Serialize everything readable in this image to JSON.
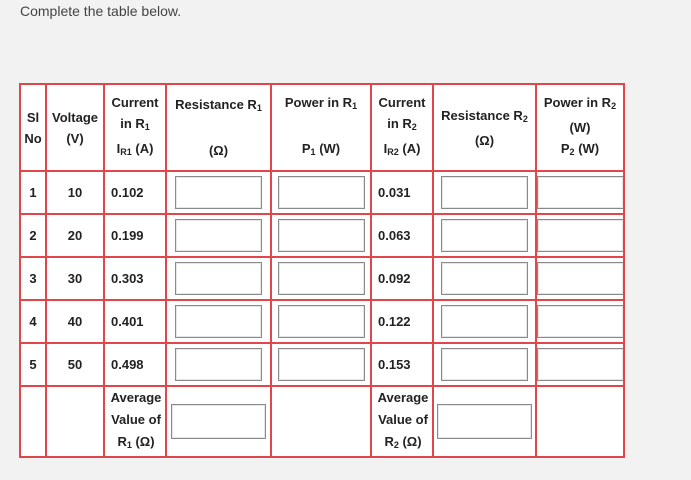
{
  "instruction": "Complete the table below.",
  "headers": {
    "sl_no": [
      "Sl",
      "No"
    ],
    "voltage": [
      "Voltage",
      "(V)"
    ],
    "current_r1": [
      "Current",
      "in R",
      "I",
      "(A)"
    ],
    "resistance_r1": [
      "Resistance R",
      "(Ω)"
    ],
    "power_r1": [
      "Power in R",
      "P",
      "(W)"
    ],
    "current_r2": [
      "Current",
      "in R",
      "I",
      "(A)"
    ],
    "resistance_r2": [
      "Resistance R",
      "(Ω)"
    ],
    "power_r2": [
      "Power in R",
      "(W)",
      "P",
      "(W)"
    ],
    "sub1": "1",
    "sub2": "2",
    "subR1": "R1",
    "subR2": "R2"
  },
  "rows": [
    {
      "sl": "1",
      "voltage": "10",
      "i_r1": "0.102",
      "i_r2": "0.031"
    },
    {
      "sl": "2",
      "voltage": "20",
      "i_r1": "0.199",
      "i_r2": "0.063"
    },
    {
      "sl": "3",
      "voltage": "30",
      "i_r1": "0.303",
      "i_r2": "0.092"
    },
    {
      "sl": "4",
      "voltage": "40",
      "i_r1": "0.401",
      "i_r2": "0.122"
    },
    {
      "sl": "5",
      "voltage": "50",
      "i_r1": "0.498",
      "i_r2": "0.153"
    }
  ],
  "average": {
    "r1_label": [
      "Average",
      "Value of",
      "R",
      "(Ω)"
    ],
    "r2_label": [
      "Average",
      "Value of",
      "R",
      "(Ω)"
    ]
  },
  "colors": {
    "border": "#e0464a",
    "background": "#f2f2f2",
    "input_border": "#8a8a8a"
  }
}
